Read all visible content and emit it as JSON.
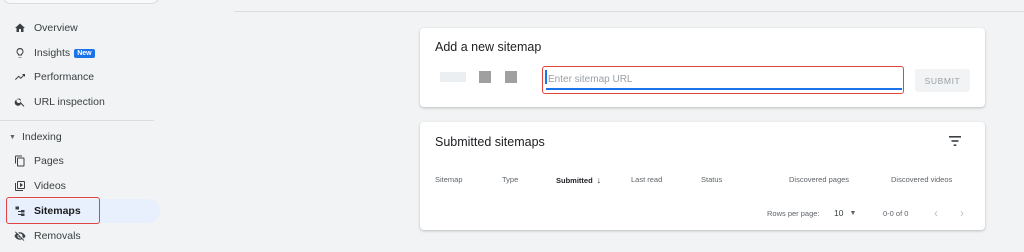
{
  "sidebar": {
    "items": [
      {
        "label": "Overview",
        "icon": "home-icon"
      },
      {
        "label": "Insights",
        "icon": "lightbulb-icon",
        "badge": "New"
      },
      {
        "label": "Performance",
        "icon": "trending-up-icon"
      },
      {
        "label": "URL inspection",
        "icon": "search-icon"
      }
    ],
    "section": {
      "label": "Indexing",
      "items": [
        {
          "label": "Pages",
          "icon": "pages-icon"
        },
        {
          "label": "Videos",
          "icon": "video-icon"
        },
        {
          "label": "Sitemaps",
          "icon": "sitemap-icon",
          "active": true
        },
        {
          "label": "Removals",
          "icon": "eye-off-icon"
        }
      ]
    }
  },
  "add_sitemap": {
    "title": "Add a new sitemap",
    "input_placeholder": "Enter sitemap URL",
    "input_value": "",
    "submit_label": "SUBMIT"
  },
  "submitted": {
    "title": "Submitted sitemaps",
    "columns": [
      "Sitemap",
      "Type",
      "Submitted",
      "Last read",
      "Status",
      "Discovered pages",
      "Discovered videos"
    ],
    "sorted_column": "Submitted",
    "rows_per_page_label": "Rows per page:",
    "rows_per_page": "10",
    "range": "0-0 of 0"
  },
  "colors": {
    "accent": "#1a73e8",
    "highlight_red": "#e0453f",
    "active_bg": "#e8f0fe",
    "page_bg": "#f1f3f4"
  }
}
